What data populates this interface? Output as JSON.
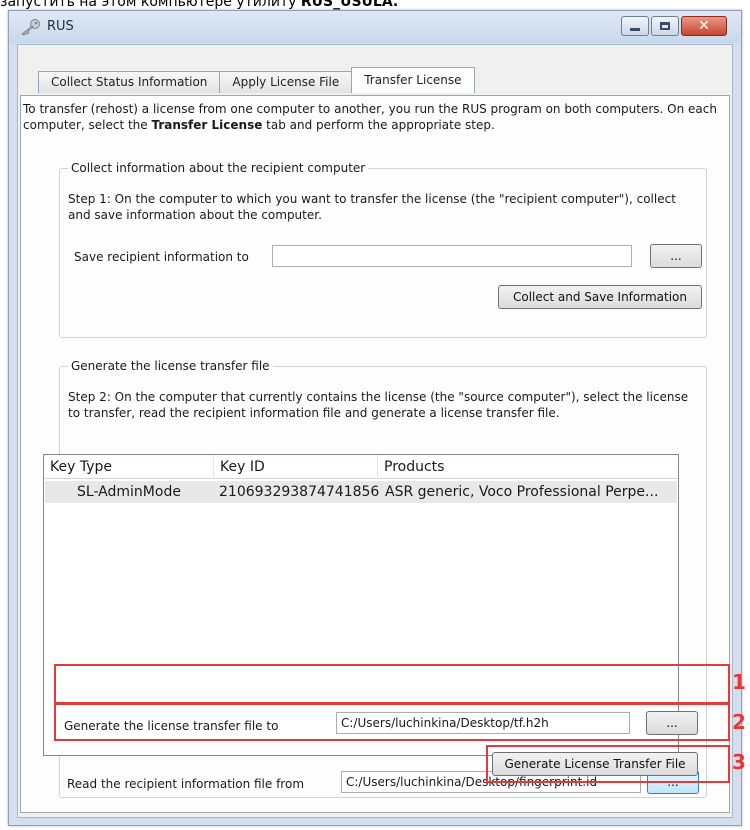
{
  "caption": {
    "prefix": "запустить на этом компьютере утилиту ",
    "bold": "RUS_USULA."
  },
  "window": {
    "title": "RUS",
    "icon": "key-icon",
    "controls": {
      "minimize": "minimize-icon",
      "maximize": "maximize-icon",
      "close": "✕"
    }
  },
  "tabs": [
    {
      "label": "Collect Status Information"
    },
    {
      "label": "Apply License File"
    },
    {
      "label": "Transfer License",
      "active": true
    }
  ],
  "intro": {
    "part1": "To transfer (rehost) a license from one computer to another, you run the RUS program on both computers. On each computer, select the ",
    "bold": "Transfer License",
    "part2": " tab and perform the appropriate step."
  },
  "group1": {
    "legend": "Collect information about the recipient computer",
    "step": "Step 1: On the computer to which you want to transfer the license (the \"recipient computer\"), collect and save information about the computer.",
    "save_label": "Save recipient information to",
    "save_value": "",
    "browse_label": "...",
    "collect_button": "Collect and Save Information"
  },
  "group2": {
    "legend": "Generate the license transfer file",
    "step": "Step 2: On the computer that currently contains the license (the \"source computer\"), select the license to transfer, read the recipient information file and generate a license transfer file.",
    "columns": [
      "Key Type",
      "Key ID",
      "Products"
    ],
    "rows": [
      {
        "key_type": "SL-AdminMode",
        "key_id": "210693293874741856",
        "products": "ASR generic, Voco Professional Perpe..."
      }
    ],
    "read_label": "Read the recipient information file from",
    "read_value": "C:/Users/luchinkina/Desktop/fingerprint.id",
    "generate_label": "Generate the license transfer file to",
    "generate_value": "C:/Users/luchinkina/Desktop/tf.h2h",
    "browse_label": "...",
    "generate_button": "Generate License Transfer File"
  },
  "markers": [
    "1",
    "2",
    "3"
  ],
  "colors": {
    "highlight": "#e33b3b",
    "titlebar": "#c8d8ec",
    "row_selected": "#e8e8e8"
  }
}
